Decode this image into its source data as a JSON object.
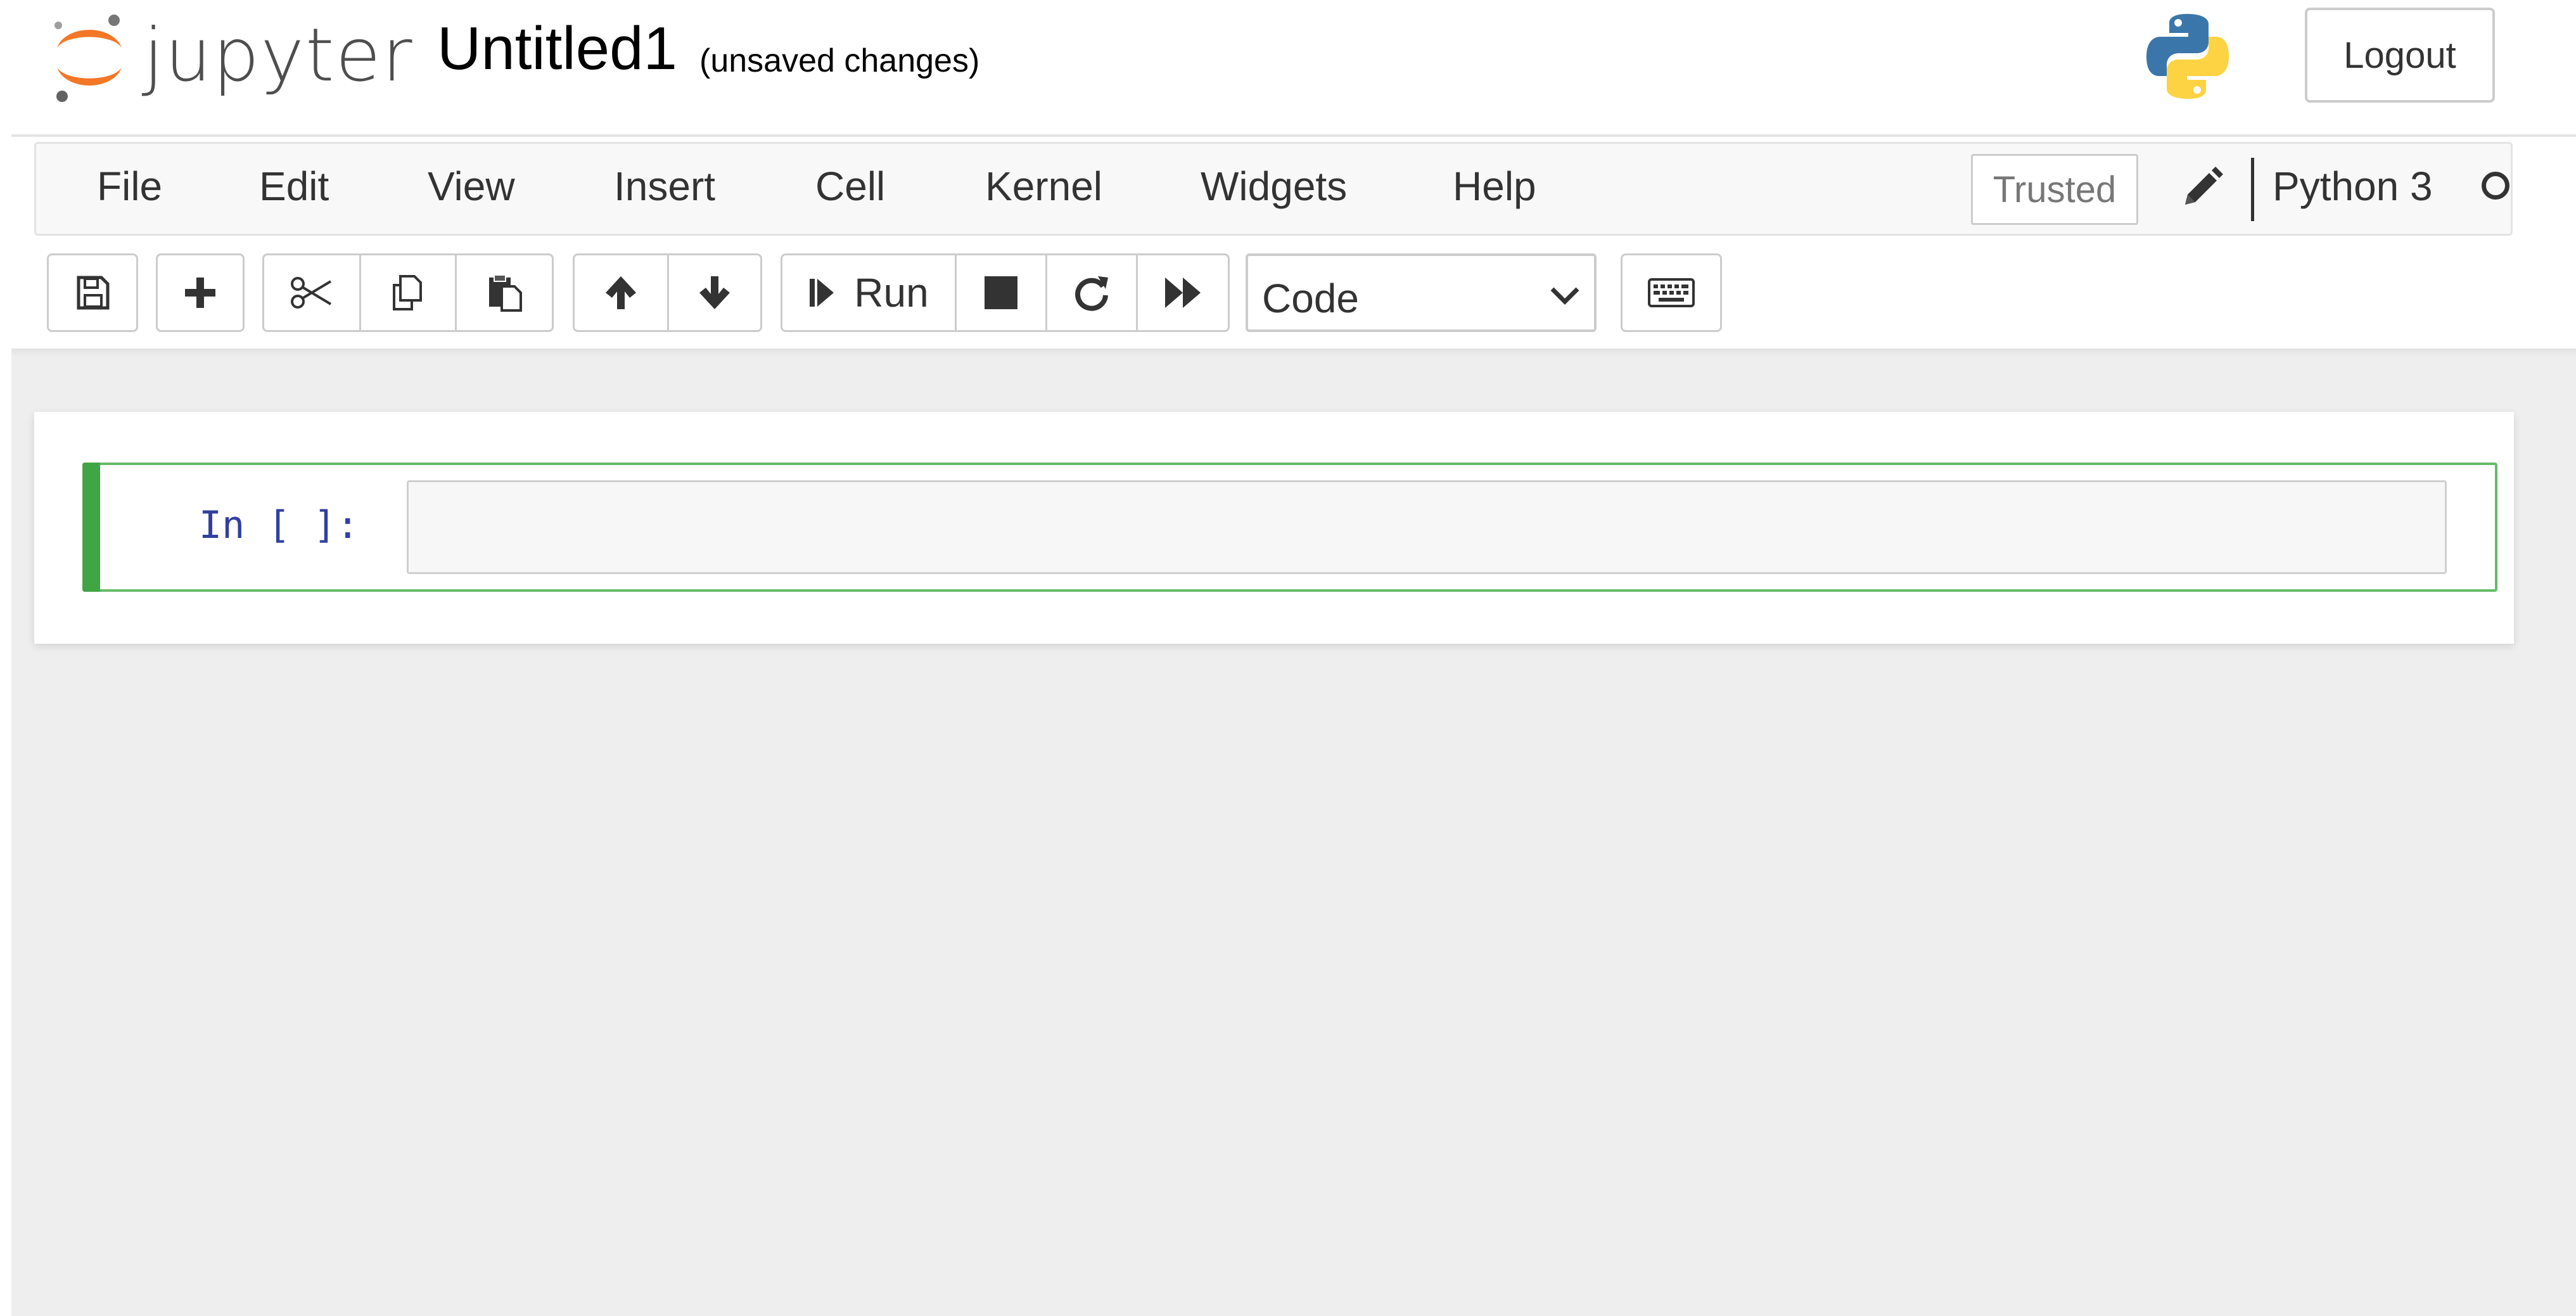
{
  "header": {
    "logo_text": "jupyter",
    "notebook_title": "Untitled1",
    "save_status": "(unsaved changes)",
    "logout_label": "Logout"
  },
  "menubar": {
    "items": [
      "File",
      "Edit",
      "View",
      "Insert",
      "Cell",
      "Kernel",
      "Widgets",
      "Help"
    ],
    "trusted_label": "Trusted",
    "kernel_name": "Python 3"
  },
  "toolbar": {
    "run_label": "Run",
    "cell_type": "Code",
    "icons": [
      "save-icon",
      "plus-icon",
      "scissors-icon",
      "copy-icon",
      "paste-icon",
      "arrow-up-icon",
      "arrow-down-icon",
      "step-forward-icon",
      "stop-icon",
      "refresh-icon",
      "fast-forward-icon",
      "keyboard-icon"
    ]
  },
  "cell": {
    "prompt": "In [ ]:",
    "source": ""
  },
  "colors": {
    "jupyter_orange": "#f37726",
    "cell_selected_border": "#66bb6a",
    "cell_selected_bar": "#42a545",
    "prompt_blue": "#303f9f",
    "page_background": "#eeeeee"
  }
}
